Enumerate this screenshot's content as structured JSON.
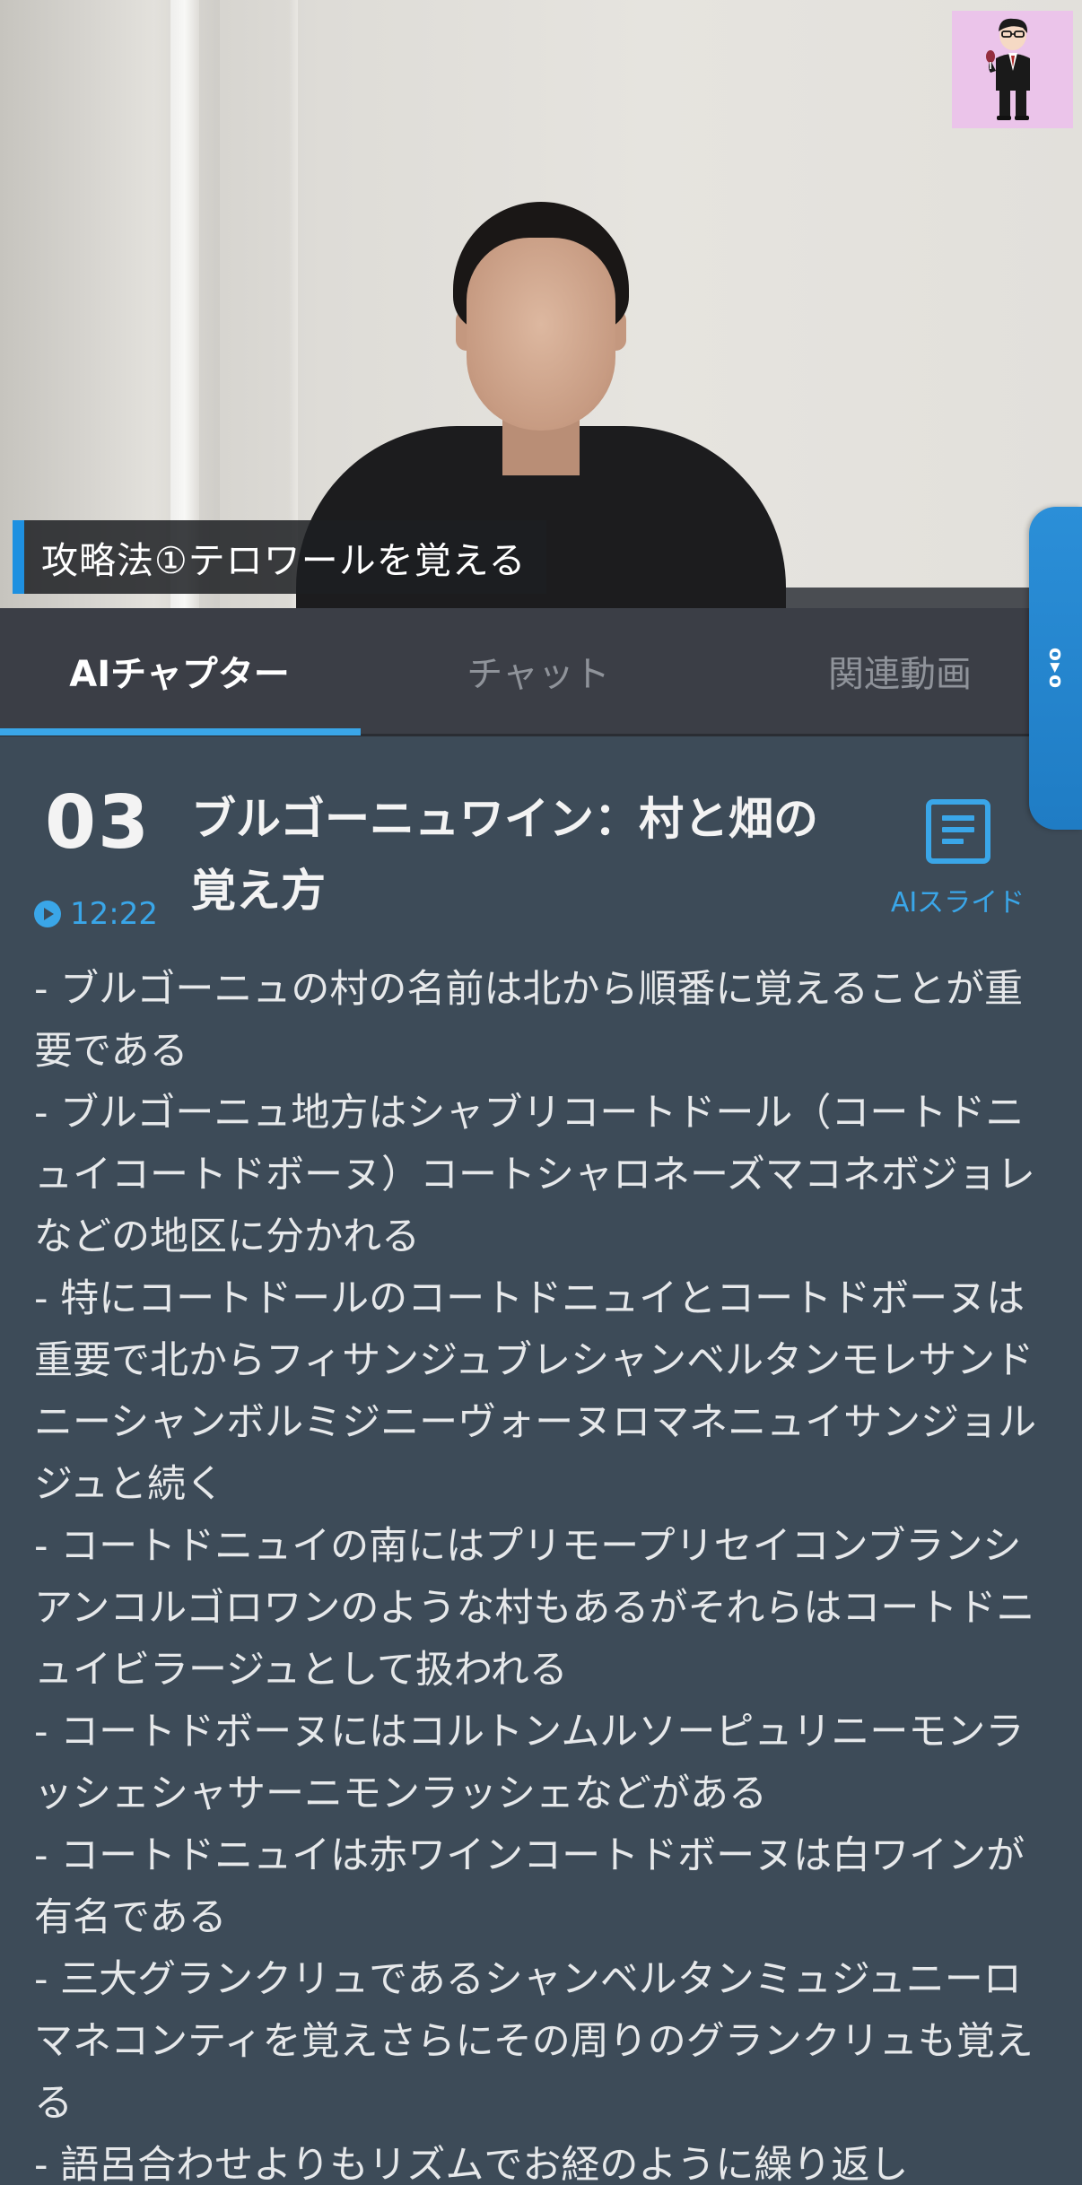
{
  "video": {
    "caption": "攻略法①テロワールを覚える"
  },
  "avatar": {
    "icon": "presenter-avatar-icon"
  },
  "tabs": [
    {
      "label": "AIチャプター",
      "active": true
    },
    {
      "label": "チャット",
      "active": false
    },
    {
      "label": "関連動画",
      "active": false
    }
  ],
  "side_handle": {
    "glyph": "o▸o"
  },
  "chapter": {
    "number": "03",
    "title": "ブルゴーニュワイン：村と畑の覚え方",
    "time": "12:22",
    "slide_label": "AIスライド",
    "summary": [
      "- ブルゴーニュの村の名前は北から順番に覚えることが重要である",
      "- ブルゴーニュ地方はシャブリコートドール（コートドニュイコートドボーヌ）コートシャロネーズマコネボジョレなどの地区に分かれる",
      "- 特にコートドールのコートドニュイとコートドボーヌは重要で北からフィサンジュブレシャンベルタンモレサンドニーシャンボルミジニーヴォーヌロマネニュイサンジョルジュと続く",
      "- コートドニュイの南にはプリモープリセイコンブランシアンコルゴロワンのような村もあるがそれらはコートドニュイビラージュとして扱われる",
      "- コートドボーヌにはコルトンムルソーピュリニーモンラッシェシャサーニモンラッシェなどがある",
      "- コートドニュイは赤ワインコートドボーヌは白ワインが有名である",
      "- 三大グランクリュであるシャンベルタンミュジュニーロマネコンティを覚えさらにその周りのグランクリュも覚える",
      "- 語呂合わせよりもリズムでお経のように繰り返し"
    ]
  },
  "colors": {
    "accent": "#3aa6e8",
    "background": "#3d4b58",
    "tabbar": "#3b3e46",
    "avatar_bg": "#ebc4ea"
  }
}
